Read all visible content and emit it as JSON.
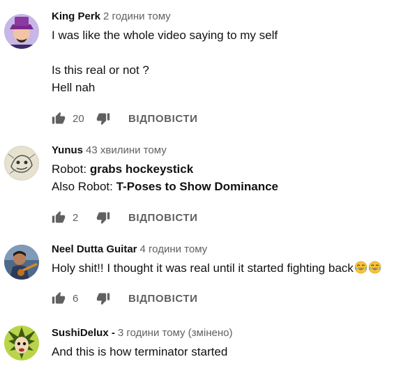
{
  "comments": [
    {
      "author": "King Perk",
      "time": "2 години тому",
      "lines": [
        "I was like the whole video saying to my self",
        "",
        "Is this real or not ?",
        "Hell nah"
      ],
      "likes": "20",
      "reply_label": "ВІДПОВІСТИ",
      "avatar_icon": "person-purple-hat-avatar"
    },
    {
      "author": "Yunus",
      "time": "43 хвилини тому",
      "line1_prefix": "Robot: ",
      "line1_bold": "grabs hockeystick",
      "line2_prefix": "Also Robot: ",
      "line2_bold": "T-Poses to Show Dominance",
      "likes": "2",
      "reply_label": "ВІДПОВІСТИ",
      "avatar_icon": "sketch-drawing-avatar"
    },
    {
      "author": "Neel Dutta Guitar",
      "time": "4 години тому",
      "line": "Holy shit!! I thought it was real until it started fighting back",
      "emojis": [
        "tears-of-joy-emoji",
        "tears-of-joy-emoji"
      ],
      "likes": "6",
      "reply_label": "ВІДПОВІСТИ",
      "avatar_icon": "guitarist-avatar"
    },
    {
      "author": "SushiDelux -",
      "time": "3 години тому (змінено)",
      "line": "And this is how terminator started",
      "avatar_icon": "anime-face-avatar"
    }
  ],
  "icons": {
    "like": "thumbs-up-icon",
    "dislike": "thumbs-down-icon"
  },
  "colors": {
    "secondary_text": "#606060",
    "primary_text": "#111111"
  }
}
